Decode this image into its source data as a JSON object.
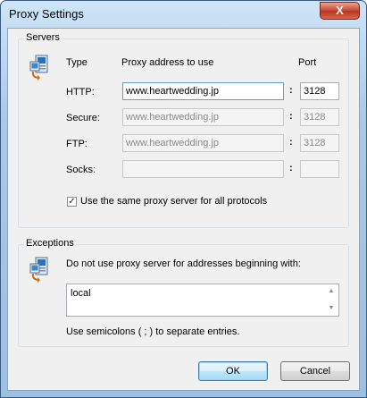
{
  "window": {
    "title": "Proxy Settings",
    "close_label": "X"
  },
  "servers": {
    "group_label": "Servers",
    "col_type": "Type",
    "col_address": "Proxy address to use",
    "col_port": "Port",
    "rows": [
      {
        "type": "HTTP:",
        "address": "www.heartwedding.jp",
        "sep": ":",
        "port": "3128"
      },
      {
        "type": "Secure:",
        "address": "www.heartwedding.jp",
        "sep": ":",
        "port": "3128"
      },
      {
        "type": "FTP:",
        "address": "www.heartwedding.jp",
        "sep": ":",
        "port": "3128"
      },
      {
        "type": "Socks:",
        "address": "",
        "sep": ":",
        "port": ""
      }
    ],
    "same_proxy_label": "Use the same proxy server for all protocols",
    "same_proxy_checked": true
  },
  "exceptions": {
    "group_label": "Exceptions",
    "description": "Do not use proxy server for addresses beginning with:",
    "value": "local",
    "hint": "Use semicolons ( ; ) to separate entries."
  },
  "buttons": {
    "ok": "OK",
    "cancel": "Cancel"
  }
}
